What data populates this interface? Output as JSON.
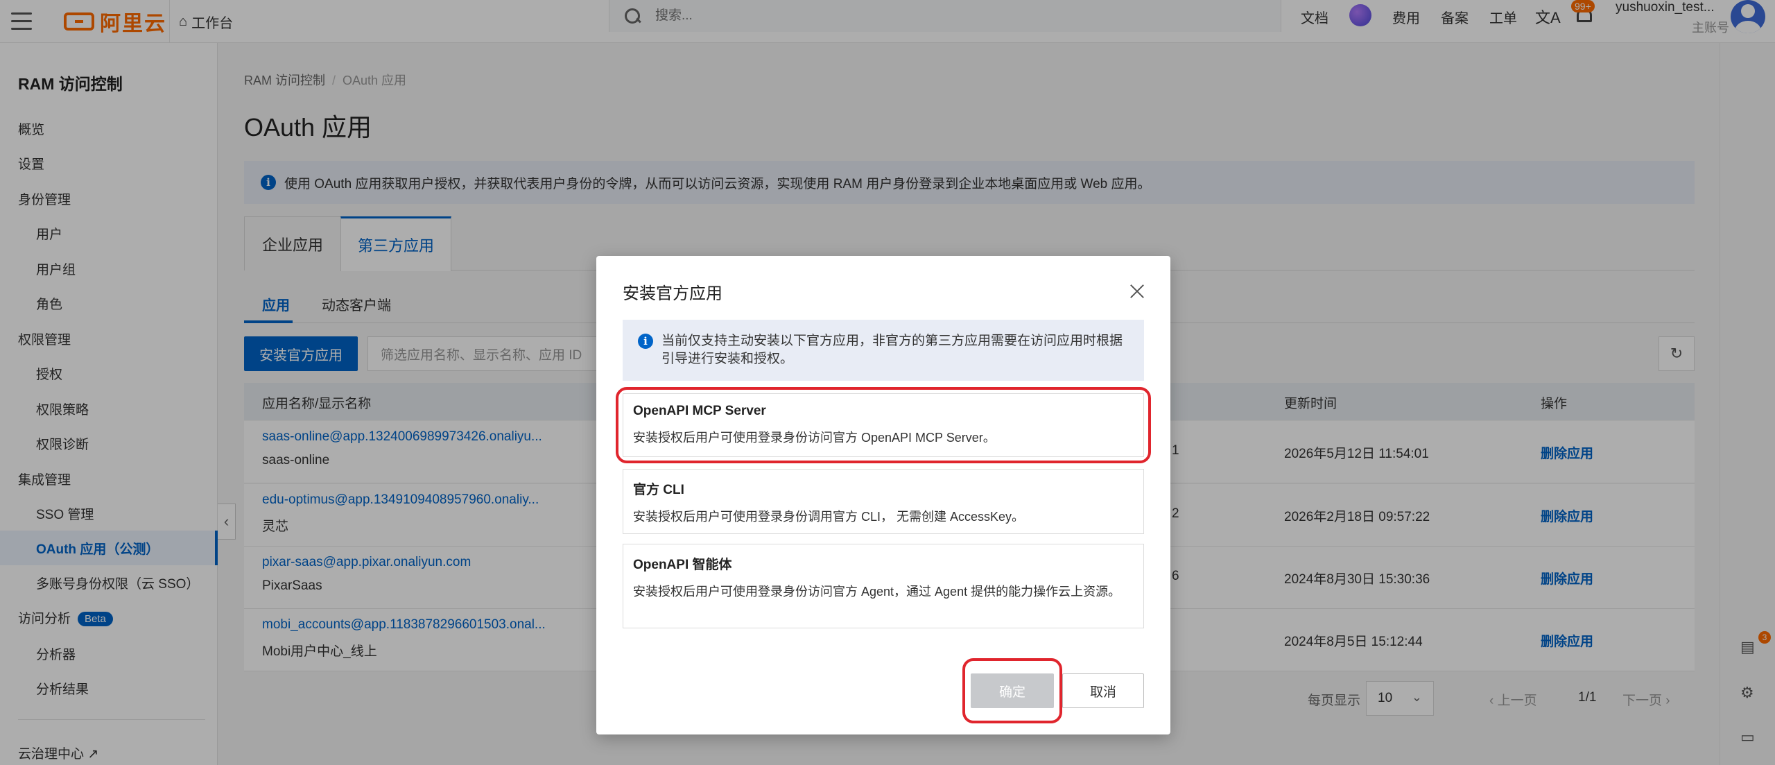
{
  "topbar": {
    "logo": "阿里云",
    "workbench": "工作台",
    "search_placeholder": "搜索...",
    "links": [
      "文档",
      "费用",
      "备案",
      "工单"
    ],
    "notification_count": "99+",
    "user_name": "yushuoxin_test...",
    "user_role": "主账号"
  },
  "sidebar": {
    "title": "RAM 访问控制",
    "items": [
      "概览",
      "设置",
      "身份管理",
      "用户",
      "用户组",
      "角色",
      "权限管理",
      "授权",
      "权限策略",
      "权限诊断",
      "集成管理",
      "SSO 管理",
      "OAuth 应用（公测）",
      "多账号身份权限（云 SSO）",
      "访问分析",
      "分析器",
      "分析结果",
      "云治理中心"
    ],
    "beta": "Beta"
  },
  "breadcrumb": [
    "RAM 访问控制",
    "OAuth 应用"
  ],
  "page_title": "OAuth 应用",
  "notice": "使用 OAuth 应用获取用户授权，并获取代表用户身份的令牌，从而可以访问云资源，实现使用 RAM 用户身份登录到企业本地桌面应用或 Web 应用。",
  "tabs": [
    "企业应用",
    "第三方应用"
  ],
  "subtabs": [
    "应用",
    "动态客户端"
  ],
  "toolbar": {
    "install_button": "安装官方应用",
    "filter_placeholder": "筛选应用名称、显示名称、应用 ID"
  },
  "table": {
    "headers": [
      "应用名称/显示名称",
      "更新时间",
      "操作"
    ],
    "rows": [
      {
        "name": "saas-online@app.1324006989973426.onaliyu...",
        "display": "saas-online",
        "frag": "1",
        "time": "2026年5月12日 11:54:01",
        "action": "删除应用"
      },
      {
        "name": "edu-optimus@app.1349109408957960.onaliy...",
        "display": "灵芯",
        "frag": "2",
        "time": "2026年2月18日 09:57:22",
        "action": "删除应用"
      },
      {
        "name": "pixar-saas@app.pixar.onaliyun.com",
        "display": "PixarSaas",
        "frag": "6",
        "time": "2024年8月30日 15:30:36",
        "action": "删除应用"
      },
      {
        "name": "mobi_accounts@app.1183878296601503.onal...",
        "display": "Mobi用户中心_线上",
        "frag": "",
        "time": "2024年8月5日 15:12:44",
        "action": "删除应用"
      }
    ]
  },
  "pager": {
    "per_page_label": "每页显示",
    "per_page": "10",
    "prev": "上一页",
    "page": "1/1",
    "next": "下一页"
  },
  "rail_badge": "3",
  "modal": {
    "title": "安装官方应用",
    "notice": "当前仅支持主动安装以下官方应用，非官方的第三方应用需要在访问应用时根据引导进行安装和授权。",
    "options": [
      {
        "title": "OpenAPI MCP Server",
        "desc": "安装授权后用户可使用登录身份访问官方 OpenAPI MCP Server。"
      },
      {
        "title": "官方 CLI",
        "desc": "安装授权后用户可使用登录身份调用官方 CLI， 无需创建 AccessKey。"
      },
      {
        "title": "OpenAPI 智能体",
        "desc": "安装授权后用户可使用登录身份访问官方 Agent，通过 Agent 提供的能力操作云上资源。"
      }
    ],
    "confirm": "确定",
    "cancel": "取消"
  },
  "colors": {
    "primary": "#0064c8",
    "brand": "#ff6a00",
    "highlight": "#e0252d"
  }
}
